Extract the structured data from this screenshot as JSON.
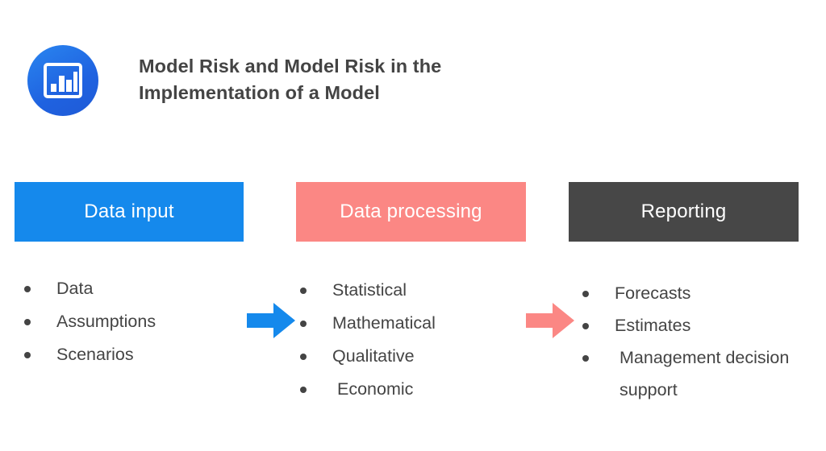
{
  "header": {
    "title": "Model Risk and Model Risk in the\nImplementation of a Model",
    "icon": "bar-chart-icon",
    "icon_color_start": "#2a86f0",
    "icon_color_end": "#1f5ad6"
  },
  "flow": {
    "stages": [
      {
        "label": "Data input",
        "color": "#1589ec",
        "items": [
          "Data",
          "Assumptions",
          "Scenarios"
        ]
      },
      {
        "label": "Data processing",
        "color": "#fb8784",
        "items": [
          "Statistical",
          "Mathematical",
          "Qualitative",
          "Economic"
        ]
      },
      {
        "label": "Reporting",
        "color": "#474747",
        "items": [
          "Forecasts",
          "Estimates",
          "Management decision support"
        ]
      }
    ],
    "arrows": [
      {
        "name": "arrow-data-input-to-data-processing",
        "color": "#1589ec"
      },
      {
        "name": "arrow-data-processing-to-reporting",
        "color": "#fb8784"
      }
    ]
  },
  "colors": {
    "text": "#444444",
    "background": "#ffffff",
    "accent_blue": "#1589ec",
    "accent_salmon": "#fb8784",
    "accent_dark": "#474747"
  }
}
